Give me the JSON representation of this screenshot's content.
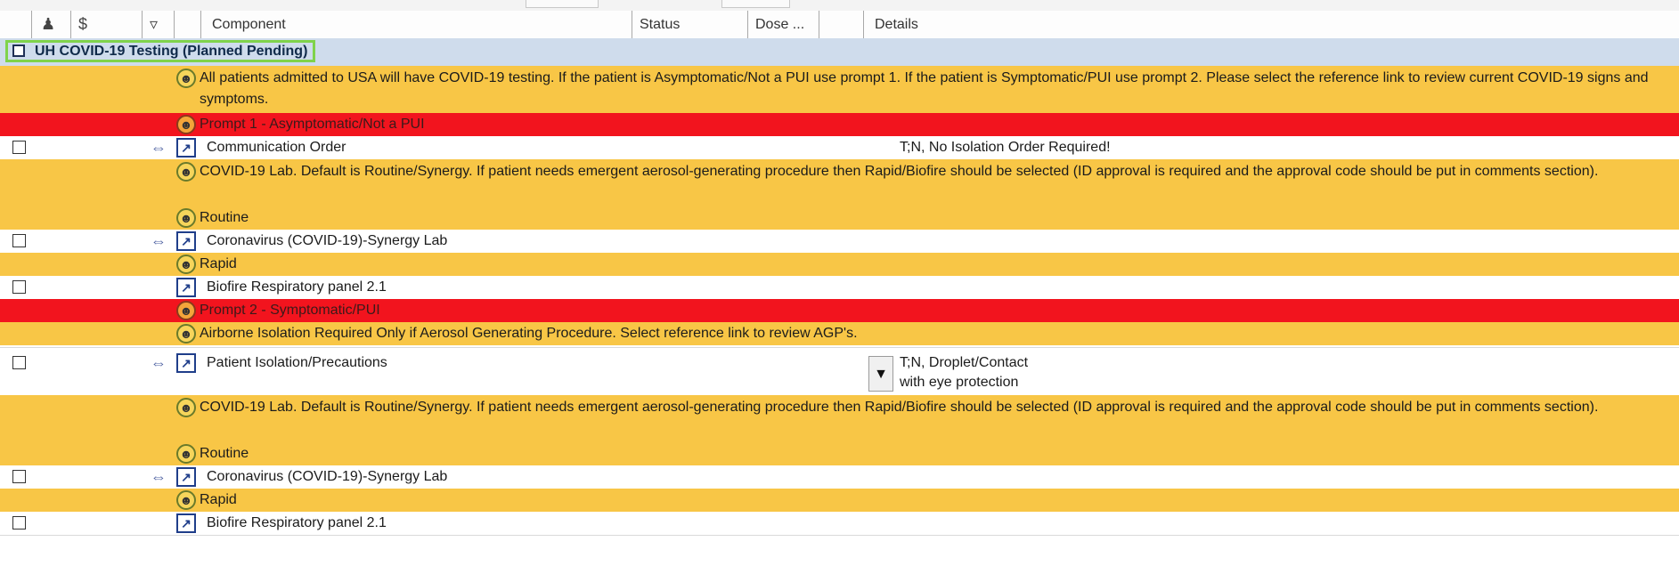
{
  "header": {
    "columns": {
      "component": "Component",
      "status": "Status",
      "dose": "Dose ...",
      "details": "Details"
    },
    "icons": [
      "people-icon",
      "dollar-icon",
      "filter-icon"
    ]
  },
  "phase": {
    "title": "UH COVID-19 Testing (Planned Pending)"
  },
  "rows": [
    {
      "type": "note",
      "text": "All patients admitted to USA will have COVID-19 testing. If the patient is Asymptomatic/Not a PUI use prompt 1. If the patient is Symptomatic/PUI use prompt 2. Please select the reference link to review current COVID-19 signs and symptoms."
    },
    {
      "type": "prompt",
      "text": "Prompt 1 - Asymptomatic/Not a PUI"
    },
    {
      "type": "order",
      "component": "Communication Order",
      "details": "T;N, No Isolation Order Required!"
    },
    {
      "type": "note",
      "text": "COVID-19 Lab. Default is Routine/Synergy. If patient needs emergent aerosol-generating procedure then Rapid/Biofire should be selected (ID approval is required and the approval code should be put in comments section)."
    },
    {
      "type": "note",
      "text": "Routine"
    },
    {
      "type": "order",
      "component": "Coronavirus (COVID-19)-Synergy Lab",
      "details": ""
    },
    {
      "type": "note",
      "text": "Rapid"
    },
    {
      "type": "order",
      "component": "Biofire Respiratory panel 2.1",
      "details": ""
    },
    {
      "type": "prompt",
      "text": "Prompt 2 - Symptomatic/PUI"
    },
    {
      "type": "note",
      "text": "Airborne Isolation Required Only if Aerosol Generating Procedure. Select reference link to review AGP's."
    },
    {
      "type": "order",
      "component": "Patient Isolation/Precautions",
      "details": "T;N, Droplet/Contact",
      "details2": "with eye protection"
    },
    {
      "type": "note",
      "text": "COVID-19 Lab. Default is Routine/Synergy. If patient needs emergent aerosol-generating procedure then Rapid/Biofire should be selected (ID approval is required and the approval code should be put in comments section)."
    },
    {
      "type": "note",
      "text": "Routine"
    },
    {
      "type": "order",
      "component": "Coronavirus (COVID-19)-Synergy Lab",
      "details": ""
    },
    {
      "type": "note",
      "text": "Rapid"
    },
    {
      "type": "order",
      "component": "Biofire Respiratory panel 2.1",
      "details": ""
    }
  ],
  "colors": {
    "note": "#f8c646",
    "prompt": "#f2141e",
    "phase": "#cfdcec",
    "highlight": "#7fd34b"
  }
}
